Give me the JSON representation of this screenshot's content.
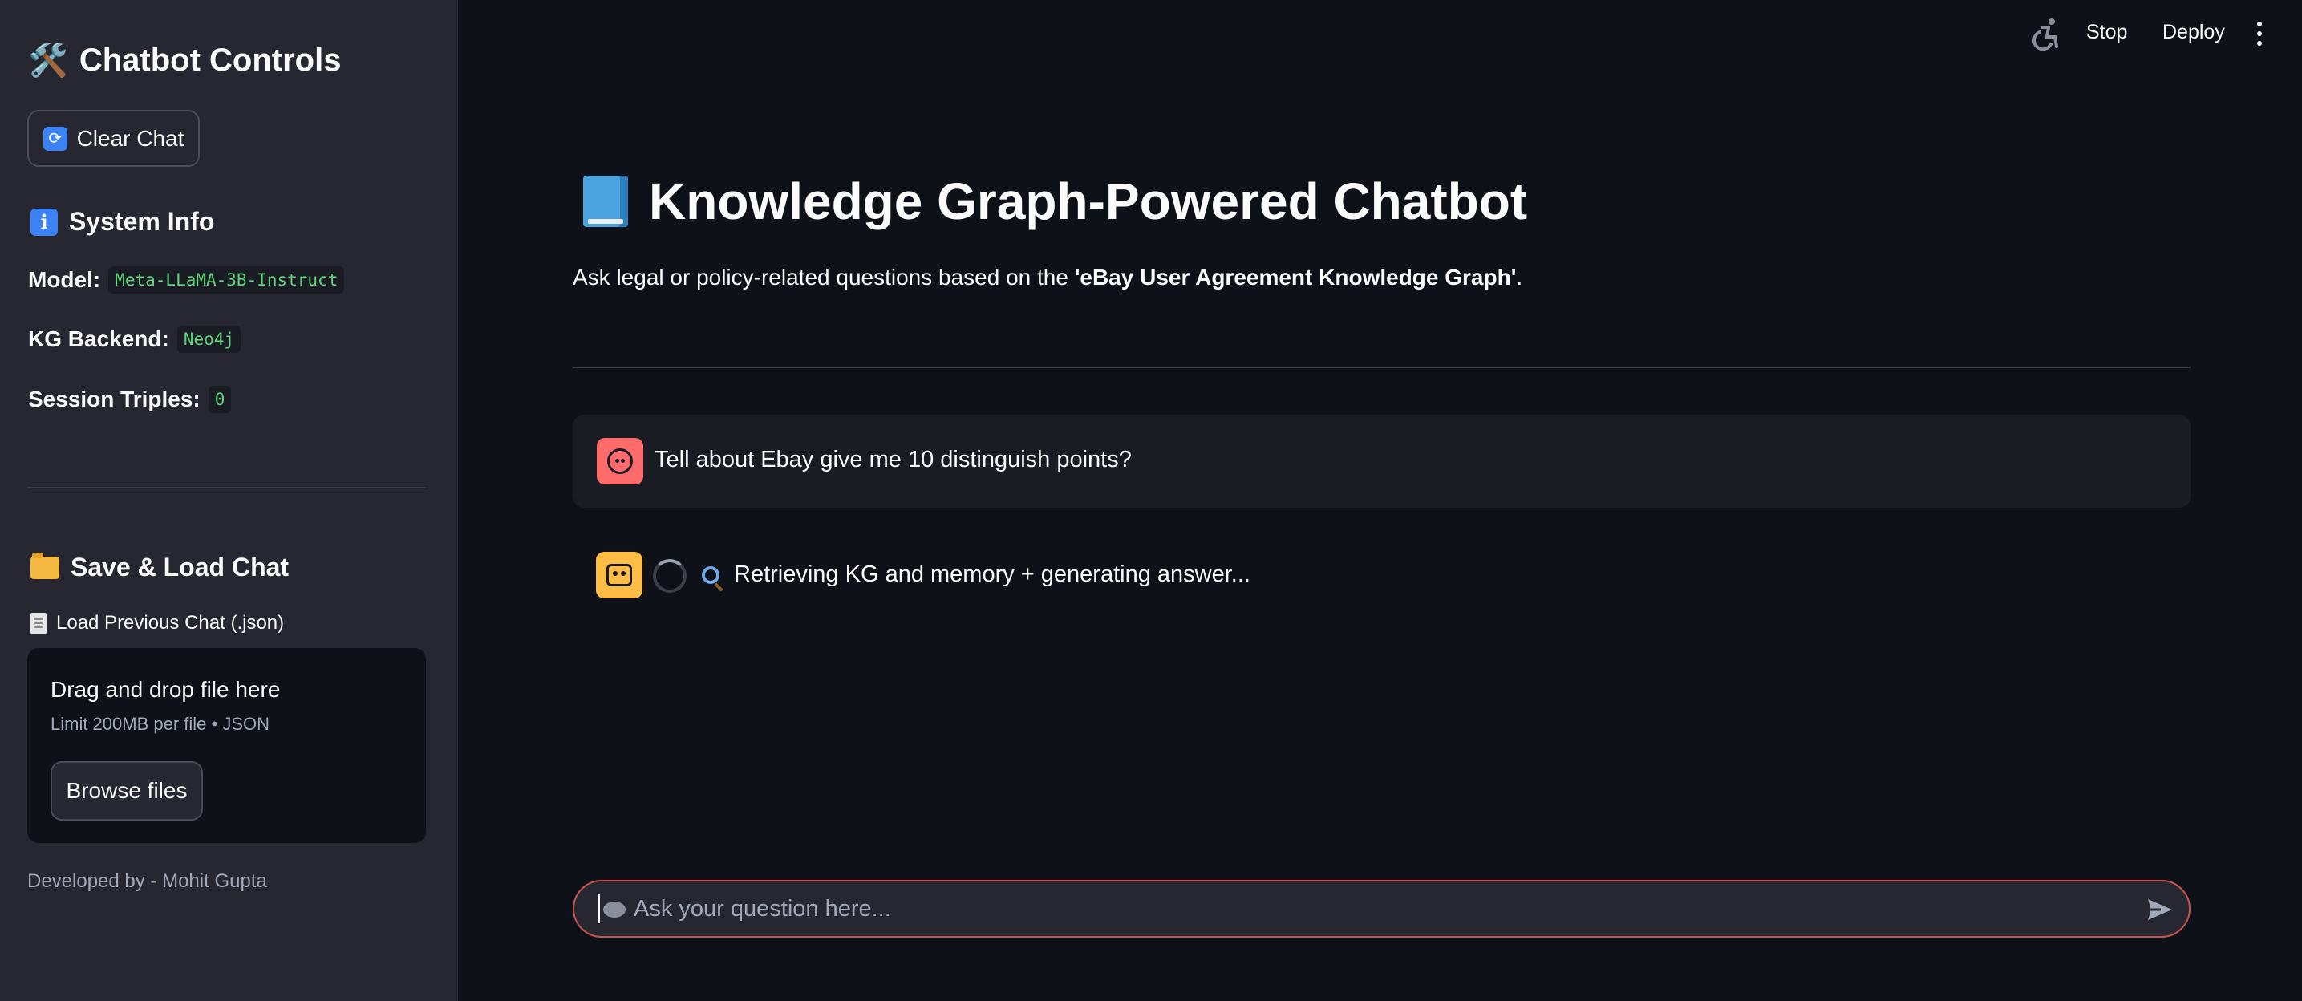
{
  "sidebar": {
    "title": "Chatbot Controls",
    "title_icon": "🛠️",
    "clear_button": "Clear Chat",
    "clear_icon": "refresh-icon",
    "system_info_heading": "System Info",
    "model_label": "Model:",
    "model_value": "Meta-LLaMA-3B-Instruct",
    "kg_label": "KG Backend:",
    "kg_value": "Neo4j",
    "triples_label": "Session Triples:",
    "triples_value": "0",
    "save_load_heading": "Save & Load Chat",
    "upload_label": "Load Previous Chat (.json)",
    "dropzone_title": "Drag and drop file here",
    "dropzone_sub": "Limit 200MB per file • JSON",
    "browse_button": "Browse files",
    "credit": "Developed by - Mohit Gupta"
  },
  "header": {
    "stop": "Stop",
    "deploy": "Deploy"
  },
  "main": {
    "title": "Knowledge Graph-Powered Chatbot",
    "subtitle_prefix": "Ask legal or policy-related questions based on the ",
    "subtitle_bold": "'eBay User Agreement Knowledge Graph'",
    "subtitle_suffix": "."
  },
  "messages": [
    {
      "role": "user",
      "text": "Tell about Ebay give me 10 distinguish points?"
    },
    {
      "role": "assistant",
      "text": "Retrieving KG and memory + generating answer..."
    }
  ],
  "chat_input": {
    "placeholder": "Ask your question here..."
  },
  "colors": {
    "background": "#0e1117",
    "sidebar": "#262730",
    "user_avatar": "#ff6b6b",
    "bot_avatar": "#ffbd45",
    "input_border": "#c9524f",
    "code_text": "#5fd47a"
  }
}
